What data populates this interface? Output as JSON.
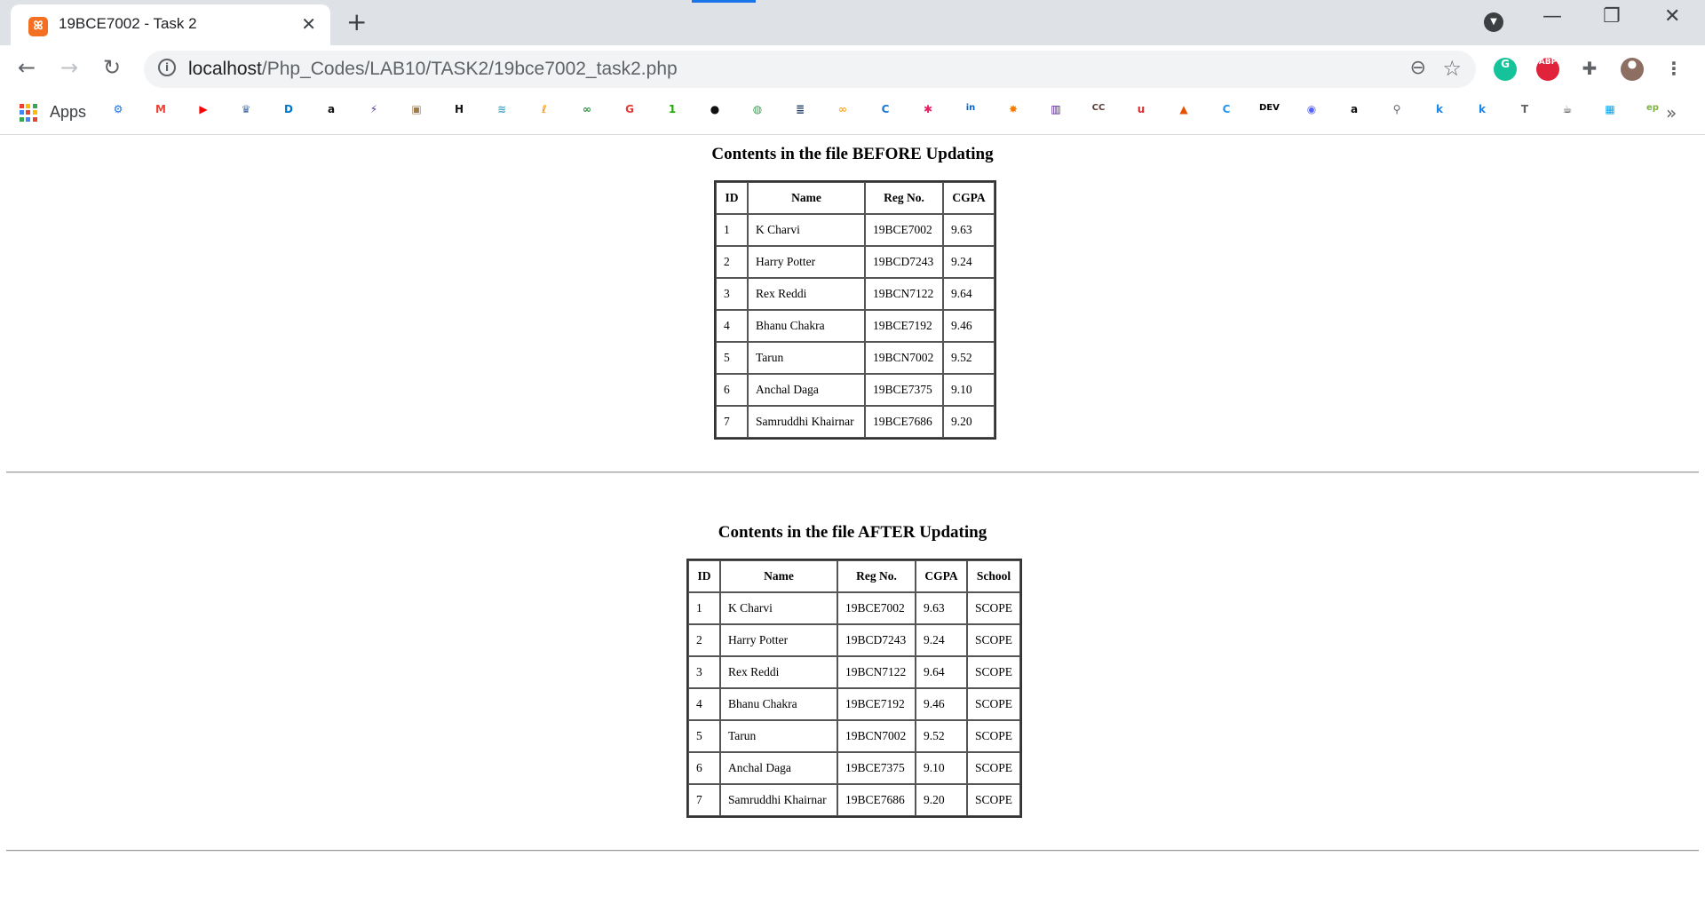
{
  "browser": {
    "tab_title": "19BCE7002 - Task 2",
    "tab_icon": "xampp-icon",
    "url_host": "localhost",
    "url_path": "/Php_Codes/LAB10/TASK2/19bce7002_task2.php",
    "apps_label": "Apps",
    "extensions": [
      {
        "name": "grammarly",
        "label": "G",
        "color": "#15c39a"
      },
      {
        "name": "adblock-plus",
        "label": "ABP",
        "color": "#e0233b"
      }
    ],
    "bookmarks": [
      {
        "icon": "settings",
        "glyph": "⚙",
        "color": "#1a73e8"
      },
      {
        "icon": "gmail",
        "glyph": "M",
        "color": "#ea4335"
      },
      {
        "icon": "youtube",
        "glyph": "▶",
        "color": "#ff0000"
      },
      {
        "icon": "university",
        "glyph": "♛",
        "color": "#4a6fa5"
      },
      {
        "icon": "dell",
        "glyph": "D",
        "color": "#0076ce"
      },
      {
        "icon": "amazon",
        "glyph": "a",
        "color": "#111111"
      },
      {
        "icon": "bolt",
        "glyph": "⚡",
        "color": "#5b3c9e"
      },
      {
        "icon": "hackerrank-image",
        "glyph": "▣",
        "color": "#9e7b4f"
      },
      {
        "icon": "hackerrank",
        "glyph": "H",
        "color": "#111111"
      },
      {
        "icon": "wave",
        "glyph": "≋",
        "color": "#4aa3c7"
      },
      {
        "icon": "leetcode",
        "glyph": "ℓ",
        "color": "#f89f1b"
      },
      {
        "icon": "geeksforgeeks",
        "glyph": "∞",
        "color": "#2f8d46"
      },
      {
        "icon": "google-g",
        "glyph": "G",
        "color": "#e53935"
      },
      {
        "icon": "one",
        "glyph": "1",
        "color": "#1faa00"
      },
      {
        "icon": "github",
        "glyph": "●",
        "color": "#111111"
      },
      {
        "icon": "codechef",
        "glyph": "◍",
        "color": "#3d9b55"
      },
      {
        "icon": "stack",
        "glyph": "≣",
        "color": "#1e3a5f"
      },
      {
        "icon": "infinity",
        "glyph": "∞",
        "color": "#f5a623"
      },
      {
        "icon": "c-circle",
        "glyph": "C",
        "color": "#1976d2"
      },
      {
        "icon": "asterisk",
        "glyph": "✱",
        "color": "#e91e63"
      },
      {
        "icon": "linkedin",
        "glyph": "in",
        "color": "#0a66c2"
      },
      {
        "icon": "sun",
        "glyph": "✸",
        "color": "#f57c00"
      },
      {
        "icon": "chart-app",
        "glyph": "▥",
        "color": "#4a148c"
      },
      {
        "icon": "cc",
        "glyph": "CC",
        "color": "#5d4037"
      },
      {
        "icon": "udemy",
        "glyph": "u",
        "color": "#d32f2f"
      },
      {
        "icon": "matlab",
        "glyph": "▲",
        "color": "#e65100"
      },
      {
        "icon": "c-blue",
        "glyph": "C",
        "color": "#2196f3"
      },
      {
        "icon": "dev",
        "glyph": "DEV",
        "color": "#000000"
      },
      {
        "icon": "discord",
        "glyph": "◉",
        "color": "#5865f2"
      },
      {
        "icon": "amazon-2",
        "glyph": "a",
        "color": "#111111"
      },
      {
        "icon": "search",
        "glyph": "⚲",
        "color": "#5f6368"
      },
      {
        "icon": "k-1",
        "glyph": "k",
        "color": "#1e88e5"
      },
      {
        "icon": "k-2",
        "glyph": "k",
        "color": "#1e88e5"
      },
      {
        "icon": "t",
        "glyph": "T",
        "color": "#5f6368"
      },
      {
        "icon": "coffee",
        "glyph": "☕",
        "color": "#333333"
      },
      {
        "icon": "microsoft",
        "glyph": "▦",
        "color": "#00a4ef"
      },
      {
        "icon": "ep",
        "glyph": "ep",
        "color": "#7cb342"
      }
    ]
  },
  "before": {
    "heading": "Contents in the file BEFORE Updating",
    "columns": [
      "ID",
      "Name",
      "Reg No.",
      "CGPA"
    ],
    "rows": [
      [
        "1",
        "K Charvi",
        "19BCE7002",
        "9.63"
      ],
      [
        "2",
        "Harry Potter",
        "19BCD7243",
        "9.24"
      ],
      [
        "3",
        "Rex Reddi",
        "19BCN7122",
        "9.64"
      ],
      [
        "4",
        "Bhanu Chakra",
        "19BCE7192",
        "9.46"
      ],
      [
        "5",
        "Tarun",
        "19BCN7002",
        "9.52"
      ],
      [
        "6",
        "Anchal Daga",
        "19BCE7375",
        "9.10"
      ],
      [
        "7",
        "Samruddhi Khairnar",
        "19BCE7686",
        "9.20"
      ]
    ]
  },
  "after": {
    "heading": "Contents in the file AFTER Updating",
    "columns": [
      "ID",
      "Name",
      "Reg No.",
      "CGPA",
      "School"
    ],
    "rows": [
      [
        "1",
        "K Charvi",
        "19BCE7002",
        "9.63",
        "SCOPE"
      ],
      [
        "2",
        "Harry Potter",
        "19BCD7243",
        "9.24",
        "SCOPE"
      ],
      [
        "3",
        "Rex Reddi",
        "19BCN7122",
        "9.64",
        "SCOPE"
      ],
      [
        "4",
        "Bhanu Chakra",
        "19BCE7192",
        "9.46",
        "SCOPE"
      ],
      [
        "5",
        "Tarun",
        "19BCN7002",
        "9.52",
        "SCOPE"
      ],
      [
        "6",
        "Anchal Daga",
        "19BCE7375",
        "9.10",
        "SCOPE"
      ],
      [
        "7",
        "Samruddhi Khairnar",
        "19BCE7686",
        "9.20",
        "SCOPE"
      ]
    ]
  }
}
